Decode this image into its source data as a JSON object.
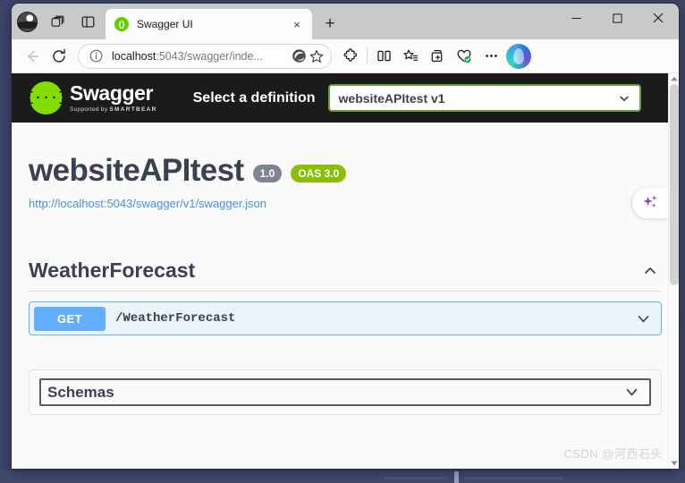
{
  "window": {
    "controls": {
      "minimize": "minimize-icon",
      "maximize": "maximize-icon",
      "close": "close-icon"
    }
  },
  "tabstrip": {
    "profile_icon": "profile-avatar-icon",
    "tab_search_icon": "tab-search-icon",
    "split_pane_icon": "vertical-tabs-icon",
    "tabs": [
      {
        "title": "Swagger UI",
        "favicon": "swagger-favicon",
        "close_label": "×",
        "active": true
      }
    ],
    "new_tab_label": "+"
  },
  "toolbar": {
    "back_icon": "back-arrow-icon",
    "refresh_icon": "refresh-icon",
    "info_icon": "site-info-icon",
    "url_prefix": "localhost",
    "url_rest": ":5043/swagger/inde...",
    "url_full": "localhost:5043/swagger/inde...",
    "read_aloud_icon": "edge-read-icon",
    "favorite_icon": "star-icon",
    "extensions_icon": "extensions-puzzle-icon",
    "split_screen_icon": "split-screen-icon",
    "favorites_icon": "favorites-list-icon",
    "collections_icon": "collections-add-icon",
    "essentials_icon": "browser-essentials-icon",
    "more_icon": "more-options-icon",
    "copilot_icon": "copilot-icon"
  },
  "swagger": {
    "brand_mark": "{···}",
    "brand_name": "Swagger",
    "brand_sub_prefix": "Supported by",
    "brand_sub_name": "SMARTBEAR",
    "definition_label": "Select a definition",
    "definition_value": "websiteAPItest v1",
    "definition_chevron": "chevron-down-icon",
    "info": {
      "title": "websiteAPItest",
      "version_badge": "1.0",
      "oas_badge": "OAS 3.0",
      "url": "http://localhost:5043/swagger/v1/swagger.json"
    },
    "tags": [
      {
        "name": "WeatherForecast",
        "toggle_icon": "chevron-up-icon",
        "operations": [
          {
            "method": "GET",
            "path": "/WeatherForecast",
            "toggle_icon": "chevron-down-icon"
          }
        ]
      }
    ],
    "schemas": {
      "title": "Schemas",
      "toggle_icon": "chevron-down-icon"
    }
  },
  "page_overlay": {
    "sparkle_icon": "ai-sparkle-icon"
  },
  "scrollbar": {
    "up_icon": "scroll-up-arrow",
    "down_icon": "scroll-down-arrow"
  },
  "watermark": "CSDN @河西石头"
}
